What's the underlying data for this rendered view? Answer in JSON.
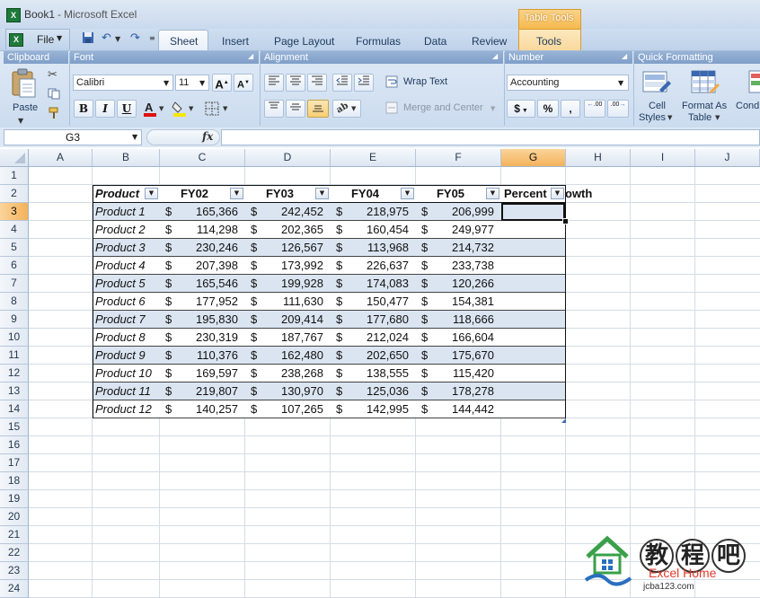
{
  "title_bar": {
    "document": "Book1",
    "separator": "-",
    "app": "Microsoft Excel"
  },
  "contextual_tab_group": "Table Tools",
  "ribbon_tabs": [
    {
      "label": "File"
    },
    {
      "label": "Sheet"
    },
    {
      "label": "Insert"
    },
    {
      "label": "Page Layout"
    },
    {
      "label": "Formulas"
    },
    {
      "label": "Data"
    },
    {
      "label": "Review"
    },
    {
      "label": "Tools"
    }
  ],
  "groups": {
    "clipboard": {
      "title": "Clipboard",
      "paste_label": "Paste"
    },
    "font": {
      "title": "Font",
      "font_name": "Calibri",
      "font_size": "11",
      "bold": "B",
      "italic": "I",
      "underline": "U",
      "grow": "A",
      "shrink": "A"
    },
    "alignment": {
      "title": "Alignment",
      "wrap_text": "Wrap Text",
      "merge_center": "Merge and Center"
    },
    "number": {
      "title": "Number",
      "format": "Accounting",
      "currency": "$",
      "percent": "%",
      "comma": ",",
      "inc_decimal": ".00",
      "dec_decimal": ".00"
    },
    "quick_formatting": {
      "title": "Quick Formatting",
      "cell_styles": "Cell Styles",
      "cell_styles_l1": "Cell",
      "cell_styles_l2": "Styles",
      "format_table_l1": "Format As",
      "format_table_l2": "Table",
      "cond_partial": "Cond"
    }
  },
  "formula_bar": {
    "name_box": "G3",
    "fx": "fx",
    "content": ""
  },
  "columns": [
    "A",
    "B",
    "C",
    "D",
    "E",
    "F",
    "G",
    "H",
    "I",
    "J"
  ],
  "rows": [
    "1",
    "2",
    "3",
    "4",
    "5",
    "6",
    "7",
    "8",
    "9",
    "10",
    "11",
    "12",
    "13",
    "14",
    "15",
    "16",
    "17",
    "18",
    "19",
    "20",
    "21",
    "22",
    "23",
    "24"
  ],
  "selected_cell": "G3",
  "table": {
    "headers": [
      "Product",
      "FY02",
      "FY03",
      "FY04",
      "FY05",
      "Percent",
      "owth"
    ],
    "currency_symbol": "$",
    "rows": [
      {
        "product": "Product 1",
        "fy02": "165,366",
        "fy03": "242,452",
        "fy04": "218,975",
        "fy05": "206,999"
      },
      {
        "product": "Product 2",
        "fy02": "114,298",
        "fy03": "202,365",
        "fy04": "160,454",
        "fy05": "249,977"
      },
      {
        "product": "Product 3",
        "fy02": "230,246",
        "fy03": "126,567",
        "fy04": "113,968",
        "fy05": "214,732"
      },
      {
        "product": "Product 4",
        "fy02": "207,398",
        "fy03": "173,992",
        "fy04": "226,637",
        "fy05": "233,738"
      },
      {
        "product": "Product 5",
        "fy02": "165,546",
        "fy03": "199,928",
        "fy04": "174,083",
        "fy05": "120,266"
      },
      {
        "product": "Product 6",
        "fy02": "177,952",
        "fy03": "111,630",
        "fy04": "150,477",
        "fy05": "154,381"
      },
      {
        "product": "Product 7",
        "fy02": "195,830",
        "fy03": "209,414",
        "fy04": "177,680",
        "fy05": "118,666"
      },
      {
        "product": "Product 8",
        "fy02": "230,319",
        "fy03": "187,767",
        "fy04": "212,024",
        "fy05": "166,604"
      },
      {
        "product": "Product 9",
        "fy02": "110,376",
        "fy03": "162,480",
        "fy04": "202,650",
        "fy05": "175,670"
      },
      {
        "product": "Product 10",
        "fy02": "169,597",
        "fy03": "238,268",
        "fy04": "138,555",
        "fy05": "115,420"
      },
      {
        "product": "Product 11",
        "fy02": "219,807",
        "fy03": "130,970",
        "fy04": "125,036",
        "fy05": "178,278"
      },
      {
        "product": "Product 12",
        "fy02": "140,257",
        "fy03": "107,265",
        "fy04": "142,995",
        "fy05": "144,442"
      }
    ]
  },
  "watermark": {
    "chars": [
      "教",
      "程",
      "吧"
    ],
    "english": "Excel Home",
    "url": "jcba123.com"
  },
  "colors": {
    "accent": "#f4b25a",
    "band": "#dbe5f1",
    "ribbon": "#cbdcef"
  }
}
